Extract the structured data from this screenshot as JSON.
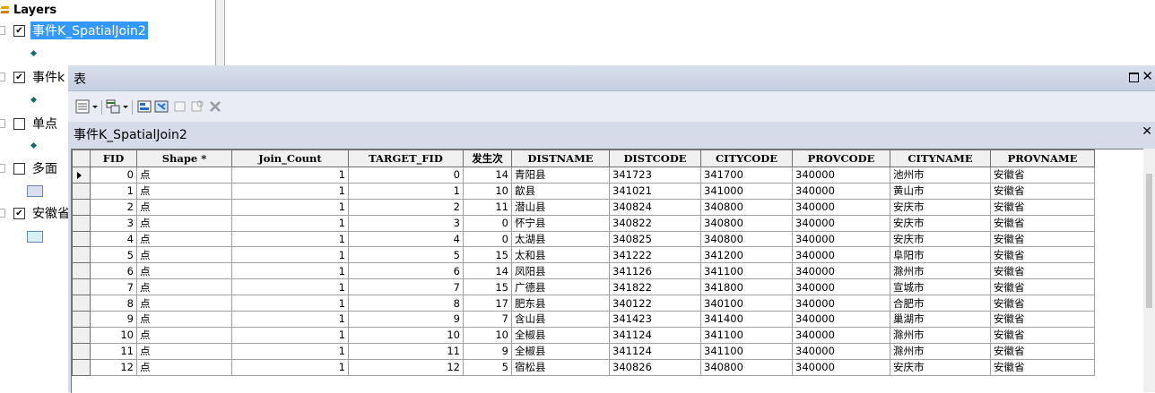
{
  "toc": {
    "root_label": "Layers",
    "layers": [
      {
        "label": "事件K_SpatialJoin2",
        "checked": true
      },
      {
        "label": "事件k",
        "checked": true
      },
      {
        "label": "单点",
        "checked": false
      },
      {
        "label": "多面",
        "checked": false
      },
      {
        "label": "安徽省",
        "checked": true
      }
    ]
  },
  "window": {
    "title": "表",
    "tab_label": "事件K_SpatialJoin2"
  },
  "columns": [
    "FID",
    "Shape *",
    "Join_Count",
    "TARGET_FID",
    "发生次",
    "DISTNAME",
    "DISTCODE",
    "CITYCODE",
    "PROVCODE",
    "CITYNAME",
    "PROVNAME"
  ],
  "rows": [
    {
      "FID": "0",
      "Shape": "点",
      "Join_Count": "1",
      "TARGET_FID": "0",
      "count": "14",
      "DISTNAME": "青阳县",
      "DISTCODE": "341723",
      "CITYCODE": "341700",
      "PROVCODE": "340000",
      "CITYNAME": "池州市",
      "PROVNAME": "安徽省"
    },
    {
      "FID": "1",
      "Shape": "点",
      "Join_Count": "1",
      "TARGET_FID": "1",
      "count": "10",
      "DISTNAME": "歙县",
      "DISTCODE": "341021",
      "CITYCODE": "341000",
      "PROVCODE": "340000",
      "CITYNAME": "黄山市",
      "PROVNAME": "安徽省"
    },
    {
      "FID": "2",
      "Shape": "点",
      "Join_Count": "1",
      "TARGET_FID": "2",
      "count": "11",
      "DISTNAME": "潜山县",
      "DISTCODE": "340824",
      "CITYCODE": "340800",
      "PROVCODE": "340000",
      "CITYNAME": "安庆市",
      "PROVNAME": "安徽省"
    },
    {
      "FID": "3",
      "Shape": "点",
      "Join_Count": "1",
      "TARGET_FID": "3",
      "count": "0",
      "DISTNAME": "怀宁县",
      "DISTCODE": "340822",
      "CITYCODE": "340800",
      "PROVCODE": "340000",
      "CITYNAME": "安庆市",
      "PROVNAME": "安徽省"
    },
    {
      "FID": "4",
      "Shape": "点",
      "Join_Count": "1",
      "TARGET_FID": "4",
      "count": "0",
      "DISTNAME": "太湖县",
      "DISTCODE": "340825",
      "CITYCODE": "340800",
      "PROVCODE": "340000",
      "CITYNAME": "安庆市",
      "PROVNAME": "安徽省"
    },
    {
      "FID": "5",
      "Shape": "点",
      "Join_Count": "1",
      "TARGET_FID": "5",
      "count": "15",
      "DISTNAME": "太和县",
      "DISTCODE": "341222",
      "CITYCODE": "341200",
      "PROVCODE": "340000",
      "CITYNAME": "阜阳市",
      "PROVNAME": "安徽省"
    },
    {
      "FID": "6",
      "Shape": "点",
      "Join_Count": "1",
      "TARGET_FID": "6",
      "count": "14",
      "DISTNAME": "凤阳县",
      "DISTCODE": "341126",
      "CITYCODE": "341100",
      "PROVCODE": "340000",
      "CITYNAME": "滁州市",
      "PROVNAME": "安徽省"
    },
    {
      "FID": "7",
      "Shape": "点",
      "Join_Count": "1",
      "TARGET_FID": "7",
      "count": "15",
      "DISTNAME": "广德县",
      "DISTCODE": "341822",
      "CITYCODE": "341800",
      "PROVCODE": "340000",
      "CITYNAME": "宣城市",
      "PROVNAME": "安徽省"
    },
    {
      "FID": "8",
      "Shape": "点",
      "Join_Count": "1",
      "TARGET_FID": "8",
      "count": "17",
      "DISTNAME": "肥东县",
      "DISTCODE": "340122",
      "CITYCODE": "340100",
      "PROVCODE": "340000",
      "CITYNAME": "合肥市",
      "PROVNAME": "安徽省"
    },
    {
      "FID": "9",
      "Shape": "点",
      "Join_Count": "1",
      "TARGET_FID": "9",
      "count": "7",
      "DISTNAME": "含山县",
      "DISTCODE": "341423",
      "CITYCODE": "341400",
      "PROVCODE": "340000",
      "CITYNAME": "巢湖市",
      "PROVNAME": "安徽省"
    },
    {
      "FID": "10",
      "Shape": "点",
      "Join_Count": "1",
      "TARGET_FID": "10",
      "count": "10",
      "DISTNAME": "全椒县",
      "DISTCODE": "341124",
      "CITYCODE": "341100",
      "PROVCODE": "340000",
      "CITYNAME": "滁州市",
      "PROVNAME": "安徽省"
    },
    {
      "FID": "11",
      "Shape": "点",
      "Join_Count": "1",
      "TARGET_FID": "11",
      "count": "9",
      "DISTNAME": "全椒县",
      "DISTCODE": "341124",
      "CITYCODE": "341100",
      "PROVCODE": "340000",
      "CITYNAME": "滁州市",
      "PROVNAME": "安徽省"
    },
    {
      "FID": "12",
      "Shape": "点",
      "Join_Count": "1",
      "TARGET_FID": "12",
      "count": "5",
      "DISTNAME": "宿松县",
      "DISTCODE": "340826",
      "CITYCODE": "340800",
      "PROVCODE": "340000",
      "CITYNAME": "安庆市",
      "PROVNAME": "安徽省"
    }
  ]
}
